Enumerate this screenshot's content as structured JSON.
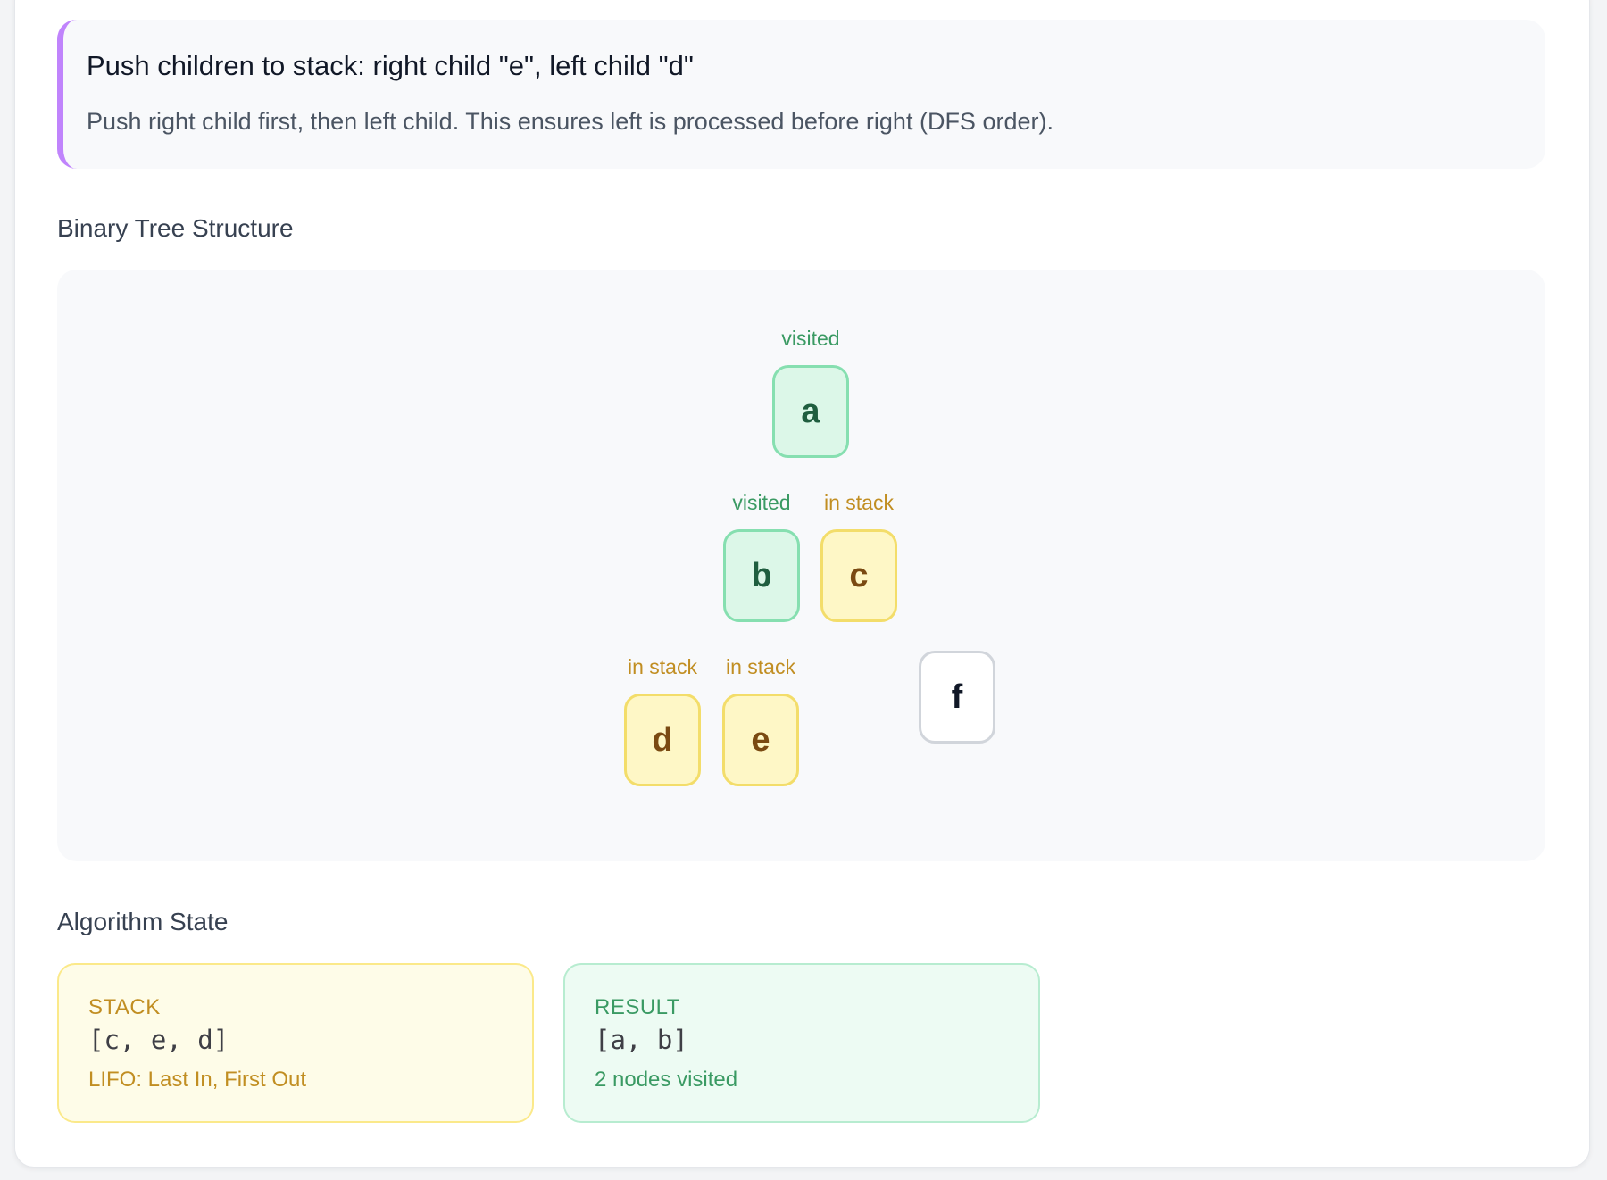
{
  "step": {
    "title": "Push children to stack: right child \"e\", left child \"d\"",
    "description": "Push right child first, then left child. This ensures left is processed before right (DFS order)."
  },
  "tree": {
    "section_title": "Binary Tree Structure",
    "nodes": [
      {
        "id": "a",
        "label": "visited",
        "status": "visited"
      },
      {
        "id": "b",
        "label": "visited",
        "status": "visited"
      },
      {
        "id": "c",
        "label": "in stack",
        "status": "in-stack"
      },
      {
        "id": "d",
        "label": "in stack",
        "status": "in-stack"
      },
      {
        "id": "e",
        "label": "in stack",
        "status": "in-stack"
      },
      {
        "id": "f",
        "label": "",
        "status": "unvisited"
      }
    ]
  },
  "state": {
    "section_title": "Algorithm State",
    "stack": {
      "header": "STACK",
      "value": "[c, e, d]",
      "note": "LIFO: Last In, First Out"
    },
    "result": {
      "header": "RESULT",
      "value": "[a, b]",
      "note": "2 nodes visited"
    }
  },
  "colors": {
    "accent": "#c084fc",
    "visited_fill": "#dcf7e8",
    "visited_border": "#86dfb0",
    "stack_fill": "#fef7c6",
    "stack_border": "#f3dd6a",
    "unvisited_border": "#d1d5db"
  }
}
